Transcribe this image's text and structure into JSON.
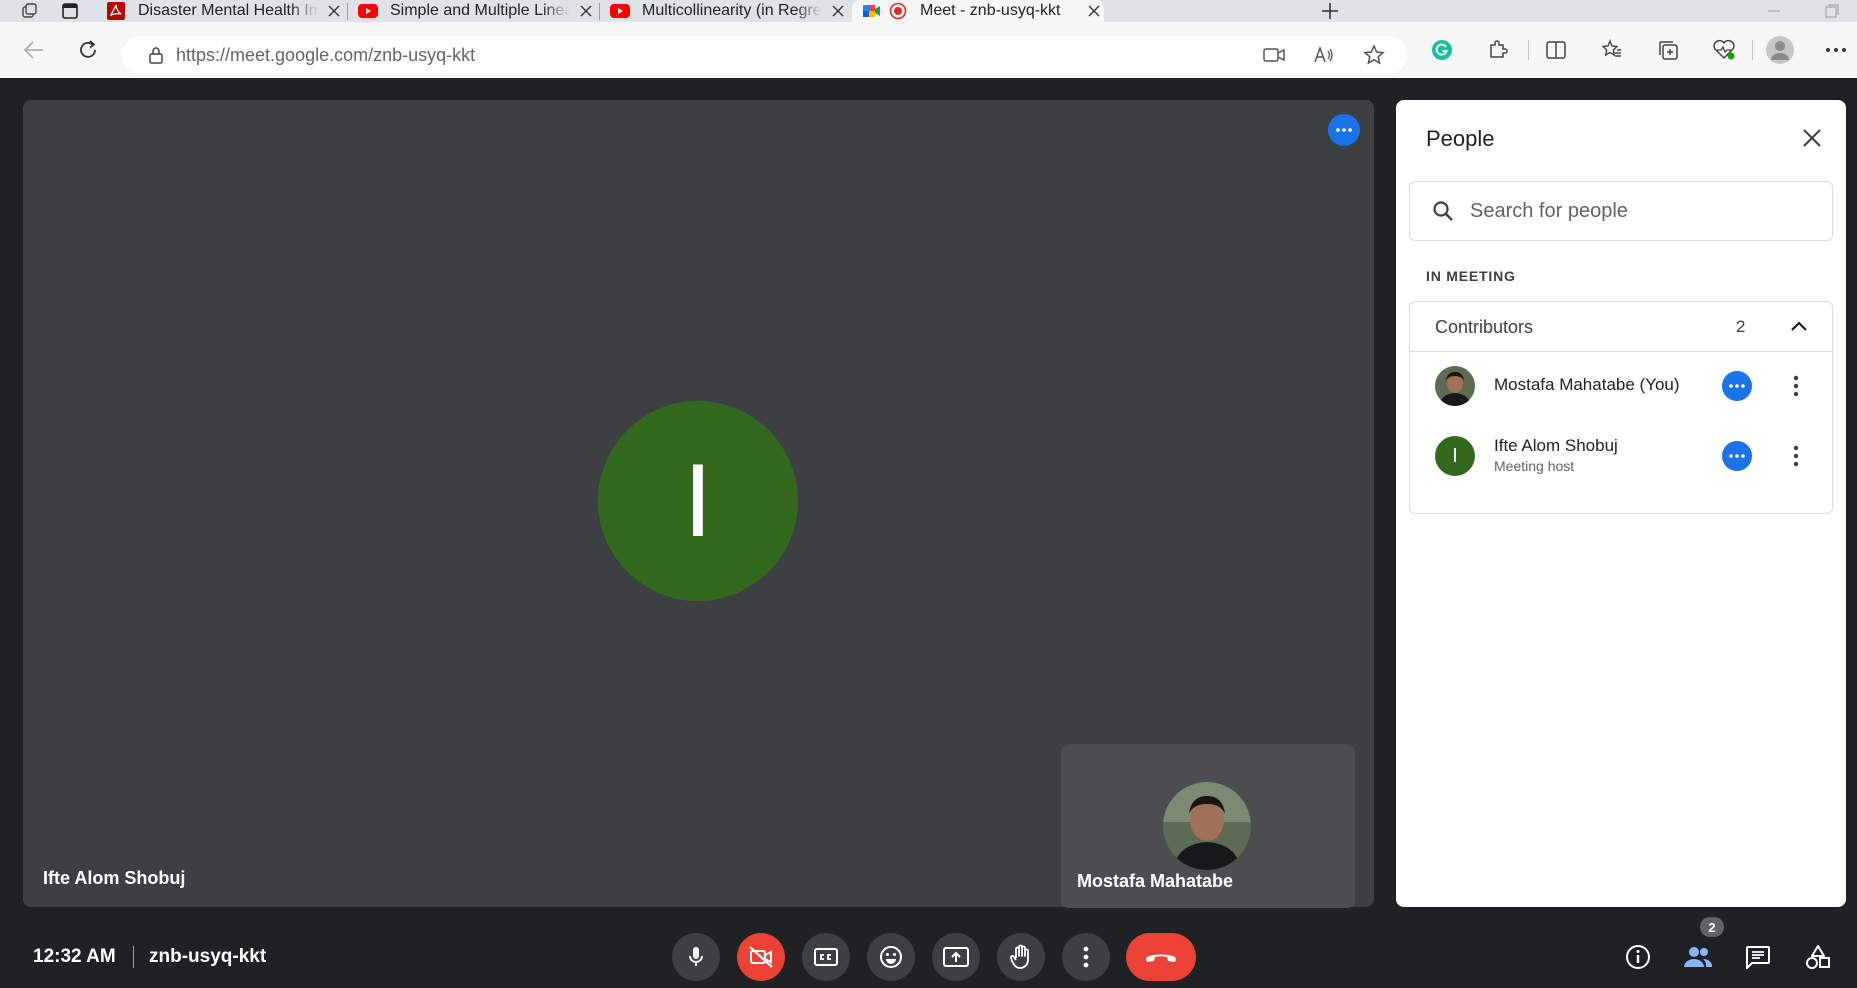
{
  "browser": {
    "tabs": [
      {
        "title": "Disaster Mental Health Impact on",
        "favicon": "pdf-icon"
      },
      {
        "title": "Simple and Multiple Linear Regre",
        "favicon": "youtube-icon"
      },
      {
        "title": "Multicollinearity (in Regression A",
        "favicon": "youtube-icon"
      },
      {
        "title": "Meet - znb-usyq-kkt",
        "favicon": "google-meet-icon",
        "active": true
      }
    ],
    "url_host": "https://meet.google.com/",
    "url_path": "znb-usyq-kkt"
  },
  "meeting": {
    "main_participant_initial": "I",
    "main_participant_name": "Ifte Alom Shobuj",
    "self_name": "Mostafa Mahatabe",
    "time": "12:32 AM",
    "code": "znb-usyq-kkt",
    "people_badge": "2"
  },
  "people_panel": {
    "title": "People",
    "search_placeholder": "Search for people",
    "section_label": "IN MEETING",
    "group_label": "Contributors",
    "group_count": "2",
    "participants": [
      {
        "name": "Mostafa Mahatabe (You)",
        "role": ""
      },
      {
        "name": "Ifte Alom Shobuj",
        "role": "Meeting host",
        "initial": "I"
      }
    ]
  },
  "colors": {
    "accent": "#1a73e8",
    "danger": "#ea4335",
    "avatar_green": "#33691e",
    "tile": "#3c4043",
    "background": "#202124"
  }
}
